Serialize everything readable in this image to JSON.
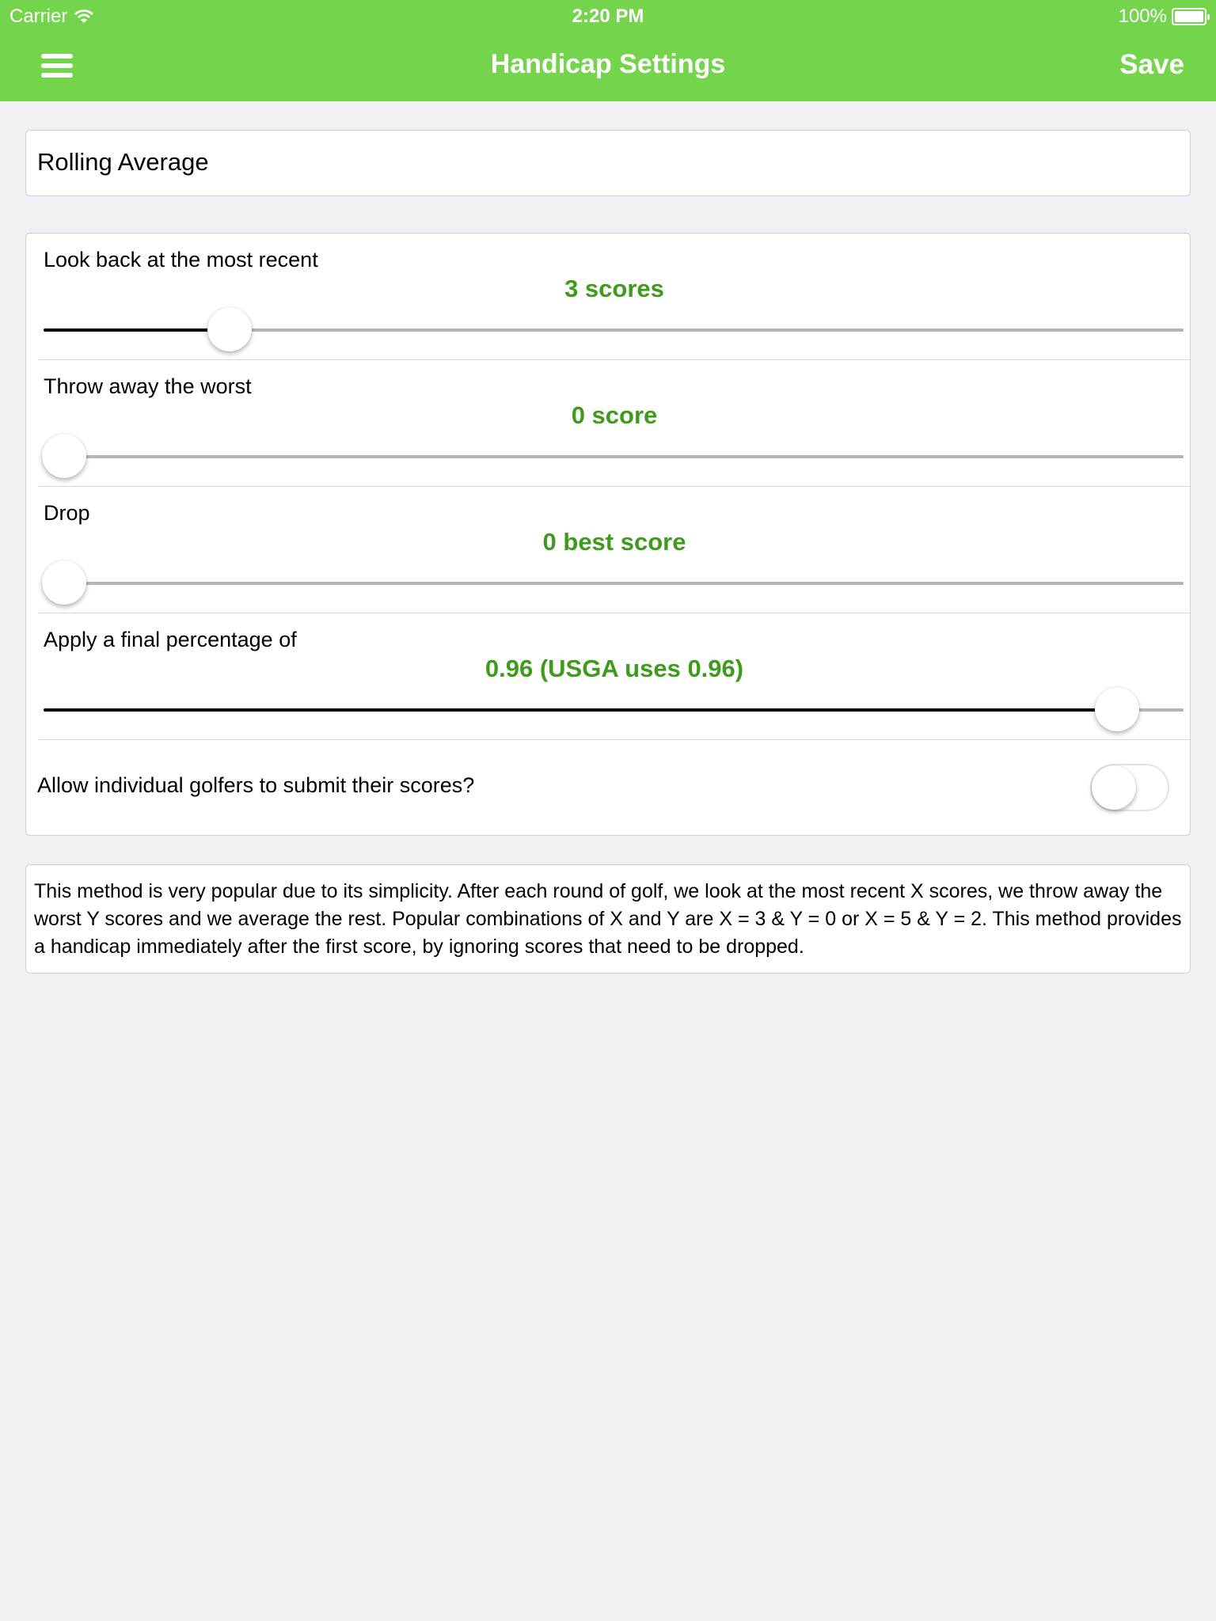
{
  "status_bar": {
    "carrier": "Carrier",
    "time": "2:20 PM",
    "battery": "100%"
  },
  "nav": {
    "title": "Handicap Settings",
    "save_label": "Save"
  },
  "method": {
    "value": "Rolling Average"
  },
  "settings": {
    "look_back": {
      "label": "Look back at the most recent",
      "value": "3 scores",
      "level": 0.163
    },
    "throw_away": {
      "label": "Throw away the worst",
      "value": "0 score",
      "level": 0.018
    },
    "drop": {
      "label": "Drop",
      "value": "0 best score",
      "level": 0.018
    },
    "percentage": {
      "label": "Apply a final percentage of",
      "value": "0.96 (USGA uses 0.96)",
      "level": 0.942
    },
    "allow_submit": {
      "label": "Allow individual golfers to submit their scores?",
      "enabled": false
    }
  },
  "description": "This method is very popular due to its simplicity. After each round of golf, we look at the most recent X scores, we throw away the worst Y scores and we average the rest. Popular combinations of X and Y are X = 3 & Y = 0 or X = 5 & Y = 2. This method provides a handicap immediately after the first score, by ignoring scores that need to be dropped.",
  "colors": {
    "nav_bar": "#74d44c",
    "value_text": "#3e9b1c",
    "background": "#efeff4"
  }
}
